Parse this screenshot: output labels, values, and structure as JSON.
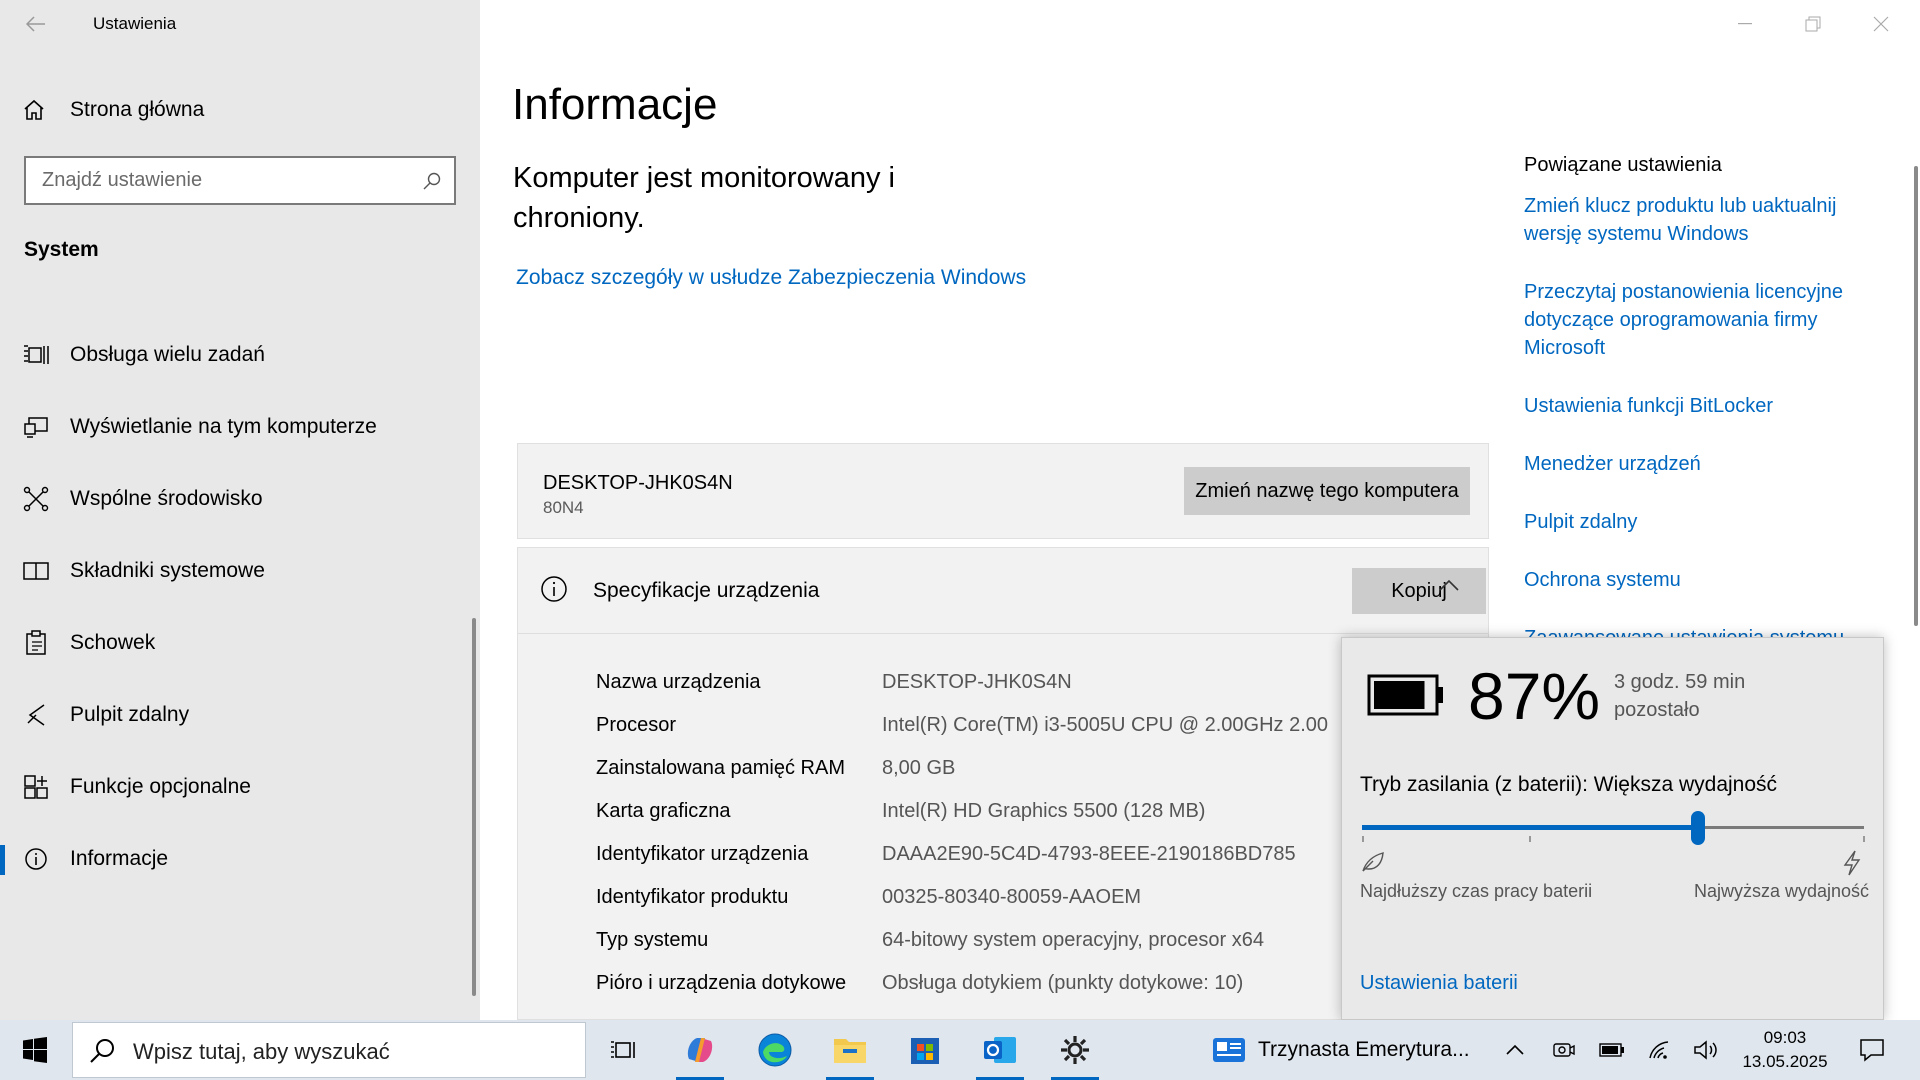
{
  "window": {
    "title": "Ustawienia"
  },
  "sidebar": {
    "home_label": "Strona główna",
    "search_placeholder": "Znajdź ustawienie",
    "section_title": "System",
    "items": [
      {
        "label": "Obsługa wielu zadań",
        "icon": "multitasking-icon"
      },
      {
        "label": "Wyświetlanie na tym komputerze",
        "icon": "projecting-icon"
      },
      {
        "label": "Wspólne środowisko",
        "icon": "shared-experiences-icon"
      },
      {
        "label": "Składniki systemowe",
        "icon": "system-components-icon"
      },
      {
        "label": "Schowek",
        "icon": "clipboard-icon"
      },
      {
        "label": "Pulpit zdalny",
        "icon": "remote-desktop-icon"
      },
      {
        "label": "Funkcje opcjonalne",
        "icon": "optional-features-icon"
      },
      {
        "label": "Informacje",
        "icon": "info-icon",
        "active": true
      }
    ]
  },
  "main": {
    "title": "Informacje",
    "protection_text": "Komputer jest monitorowany i chroniony.",
    "protection_link": "Zobacz szczegóły w usłudze Zabezpieczenia Windows",
    "device_name": "DESKTOP-JHK0S4N",
    "device_model": "80N4",
    "rename_button": "Zmień nazwę tego komputera",
    "spec_title": "Specyfikacje urządzenia",
    "copy_button": "Kopiuj",
    "specs": [
      {
        "key": "Nazwa urządzenia",
        "value": "DESKTOP-JHK0S4N"
      },
      {
        "key": "Procesor",
        "value": "Intel(R) Core(TM) i3-5005U CPU @ 2.00GHz   2.00"
      },
      {
        "key": "Zainstalowana pamięć RAM",
        "value": "8,00 GB"
      },
      {
        "key": "Karta graficzna",
        "value": "Intel(R) HD Graphics 5500 (128 MB)"
      },
      {
        "key": "Identyfikator urządzenia",
        "value": "DAAA2E90-5C4D-4793-8EEE-2190186BD785"
      },
      {
        "key": "Identyfikator produktu",
        "value": "00325-80340-80059-AAOEM"
      },
      {
        "key": "Typ systemu",
        "value": "64-bitowy system operacyjny, procesor x64"
      },
      {
        "key": "Pióro i urządzenia dotykowe",
        "value": "Obsługa dotykiem (punkty dotykowe: 10)"
      }
    ]
  },
  "related": {
    "title": "Powiązane ustawienia",
    "links": [
      "Zmień klucz produktu lub uaktualnij wersję systemu Windows",
      "Przeczytaj postanowienia licencyjne dotyczące oprogramowania firmy Microsoft",
      "Ustawienia funkcji BitLocker",
      "Menedżer urządzeń",
      "Pulpit zdalny",
      "Ochrona systemu",
      "Zaawansowane ustawienia systemu"
    ]
  },
  "battery": {
    "percent": "87%",
    "level": 0.87,
    "remaining": "3 godz. 59 min pozostało",
    "power_mode": "Tryb zasilania (z baterii): Większa wydajność",
    "slider_position": 0.67,
    "min_label": "Najdłuższy czas pracy baterii",
    "max_label": "Najwyższa wydajność",
    "settings_link": "Ustawienia baterii"
  },
  "taskbar": {
    "search_placeholder": "Wpisz tutaj, aby wyszukać",
    "news_text": "Trzynasta Emerytura...",
    "time": "09:03",
    "date": "13.05.2025"
  },
  "colors": {
    "accent": "#0067c0",
    "sidebar_bg": "#e8e8e8",
    "card_bg": "#f2f2f2",
    "taskbar_bg": "#dfe6ee"
  }
}
